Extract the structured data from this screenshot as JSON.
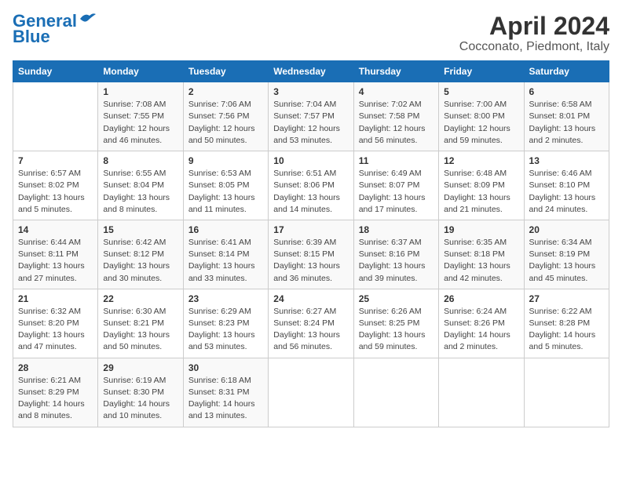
{
  "logo": {
    "line1": "General",
    "line2": "Blue"
  },
  "title": "April 2024",
  "subtitle": "Cocconato, Piedmont, Italy",
  "days_of_week": [
    "Sunday",
    "Monday",
    "Tuesday",
    "Wednesday",
    "Thursday",
    "Friday",
    "Saturday"
  ],
  "weeks": [
    [
      {
        "num": "",
        "sunrise": "",
        "sunset": "",
        "daylight": ""
      },
      {
        "num": "1",
        "sunrise": "Sunrise: 7:08 AM",
        "sunset": "Sunset: 7:55 PM",
        "daylight": "Daylight: 12 hours and 46 minutes."
      },
      {
        "num": "2",
        "sunrise": "Sunrise: 7:06 AM",
        "sunset": "Sunset: 7:56 PM",
        "daylight": "Daylight: 12 hours and 50 minutes."
      },
      {
        "num": "3",
        "sunrise": "Sunrise: 7:04 AM",
        "sunset": "Sunset: 7:57 PM",
        "daylight": "Daylight: 12 hours and 53 minutes."
      },
      {
        "num": "4",
        "sunrise": "Sunrise: 7:02 AM",
        "sunset": "Sunset: 7:58 PM",
        "daylight": "Daylight: 12 hours and 56 minutes."
      },
      {
        "num": "5",
        "sunrise": "Sunrise: 7:00 AM",
        "sunset": "Sunset: 8:00 PM",
        "daylight": "Daylight: 12 hours and 59 minutes."
      },
      {
        "num": "6",
        "sunrise": "Sunrise: 6:58 AM",
        "sunset": "Sunset: 8:01 PM",
        "daylight": "Daylight: 13 hours and 2 minutes."
      }
    ],
    [
      {
        "num": "7",
        "sunrise": "Sunrise: 6:57 AM",
        "sunset": "Sunset: 8:02 PM",
        "daylight": "Daylight: 13 hours and 5 minutes."
      },
      {
        "num": "8",
        "sunrise": "Sunrise: 6:55 AM",
        "sunset": "Sunset: 8:04 PM",
        "daylight": "Daylight: 13 hours and 8 minutes."
      },
      {
        "num": "9",
        "sunrise": "Sunrise: 6:53 AM",
        "sunset": "Sunset: 8:05 PM",
        "daylight": "Daylight: 13 hours and 11 minutes."
      },
      {
        "num": "10",
        "sunrise": "Sunrise: 6:51 AM",
        "sunset": "Sunset: 8:06 PM",
        "daylight": "Daylight: 13 hours and 14 minutes."
      },
      {
        "num": "11",
        "sunrise": "Sunrise: 6:49 AM",
        "sunset": "Sunset: 8:07 PM",
        "daylight": "Daylight: 13 hours and 17 minutes."
      },
      {
        "num": "12",
        "sunrise": "Sunrise: 6:48 AM",
        "sunset": "Sunset: 8:09 PM",
        "daylight": "Daylight: 13 hours and 21 minutes."
      },
      {
        "num": "13",
        "sunrise": "Sunrise: 6:46 AM",
        "sunset": "Sunset: 8:10 PM",
        "daylight": "Daylight: 13 hours and 24 minutes."
      }
    ],
    [
      {
        "num": "14",
        "sunrise": "Sunrise: 6:44 AM",
        "sunset": "Sunset: 8:11 PM",
        "daylight": "Daylight: 13 hours and 27 minutes."
      },
      {
        "num": "15",
        "sunrise": "Sunrise: 6:42 AM",
        "sunset": "Sunset: 8:12 PM",
        "daylight": "Daylight: 13 hours and 30 minutes."
      },
      {
        "num": "16",
        "sunrise": "Sunrise: 6:41 AM",
        "sunset": "Sunset: 8:14 PM",
        "daylight": "Daylight: 13 hours and 33 minutes."
      },
      {
        "num": "17",
        "sunrise": "Sunrise: 6:39 AM",
        "sunset": "Sunset: 8:15 PM",
        "daylight": "Daylight: 13 hours and 36 minutes."
      },
      {
        "num": "18",
        "sunrise": "Sunrise: 6:37 AM",
        "sunset": "Sunset: 8:16 PM",
        "daylight": "Daylight: 13 hours and 39 minutes."
      },
      {
        "num": "19",
        "sunrise": "Sunrise: 6:35 AM",
        "sunset": "Sunset: 8:18 PM",
        "daylight": "Daylight: 13 hours and 42 minutes."
      },
      {
        "num": "20",
        "sunrise": "Sunrise: 6:34 AM",
        "sunset": "Sunset: 8:19 PM",
        "daylight": "Daylight: 13 hours and 45 minutes."
      }
    ],
    [
      {
        "num": "21",
        "sunrise": "Sunrise: 6:32 AM",
        "sunset": "Sunset: 8:20 PM",
        "daylight": "Daylight: 13 hours and 47 minutes."
      },
      {
        "num": "22",
        "sunrise": "Sunrise: 6:30 AM",
        "sunset": "Sunset: 8:21 PM",
        "daylight": "Daylight: 13 hours and 50 minutes."
      },
      {
        "num": "23",
        "sunrise": "Sunrise: 6:29 AM",
        "sunset": "Sunset: 8:23 PM",
        "daylight": "Daylight: 13 hours and 53 minutes."
      },
      {
        "num": "24",
        "sunrise": "Sunrise: 6:27 AM",
        "sunset": "Sunset: 8:24 PM",
        "daylight": "Daylight: 13 hours and 56 minutes."
      },
      {
        "num": "25",
        "sunrise": "Sunrise: 6:26 AM",
        "sunset": "Sunset: 8:25 PM",
        "daylight": "Daylight: 13 hours and 59 minutes."
      },
      {
        "num": "26",
        "sunrise": "Sunrise: 6:24 AM",
        "sunset": "Sunset: 8:26 PM",
        "daylight": "Daylight: 14 hours and 2 minutes."
      },
      {
        "num": "27",
        "sunrise": "Sunrise: 6:22 AM",
        "sunset": "Sunset: 8:28 PM",
        "daylight": "Daylight: 14 hours and 5 minutes."
      }
    ],
    [
      {
        "num": "28",
        "sunrise": "Sunrise: 6:21 AM",
        "sunset": "Sunset: 8:29 PM",
        "daylight": "Daylight: 14 hours and 8 minutes."
      },
      {
        "num": "29",
        "sunrise": "Sunrise: 6:19 AM",
        "sunset": "Sunset: 8:30 PM",
        "daylight": "Daylight: 14 hours and 10 minutes."
      },
      {
        "num": "30",
        "sunrise": "Sunrise: 6:18 AM",
        "sunset": "Sunset: 8:31 PM",
        "daylight": "Daylight: 14 hours and 13 minutes."
      },
      {
        "num": "",
        "sunrise": "",
        "sunset": "",
        "daylight": ""
      },
      {
        "num": "",
        "sunrise": "",
        "sunset": "",
        "daylight": ""
      },
      {
        "num": "",
        "sunrise": "",
        "sunset": "",
        "daylight": ""
      },
      {
        "num": "",
        "sunrise": "",
        "sunset": "",
        "daylight": ""
      }
    ]
  ]
}
